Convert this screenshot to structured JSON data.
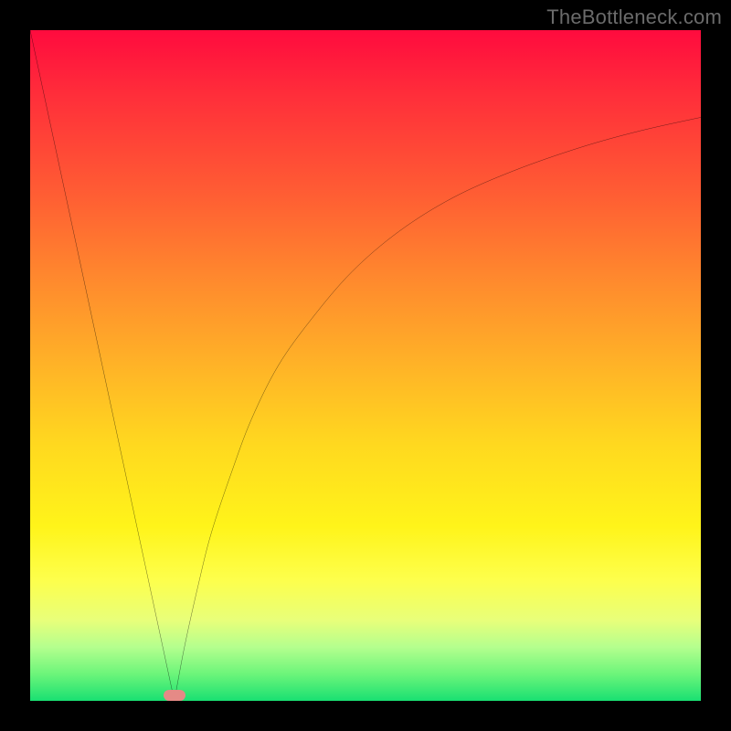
{
  "watermark": "TheBottleneck.com",
  "chart_data": {
    "type": "line",
    "title": "",
    "xlabel": "",
    "ylabel": "",
    "xlim": [
      0,
      100
    ],
    "ylim": [
      0,
      100
    ],
    "grid": false,
    "legend": false,
    "background": "heatmap-gradient (red→yellow→green vertical)",
    "series": [
      {
        "name": "left-line",
        "x": [
          0,
          21.5
        ],
        "y": [
          100,
          0
        ]
      },
      {
        "name": "right-curve",
        "x": [
          21.5,
          23,
          25,
          27,
          30,
          33,
          37,
          42,
          48,
          55,
          63,
          72,
          82,
          91,
          100
        ],
        "y": [
          0,
          8,
          17,
          25,
          34,
          42,
          50,
          57,
          64,
          70,
          75,
          79,
          82.5,
          85,
          87
        ]
      }
    ],
    "marker": {
      "name": "bottleneck-point",
      "x_center": 21.5,
      "width_pct": 3.2,
      "height_pct": 1.6,
      "color": "#e58a86"
    }
  }
}
